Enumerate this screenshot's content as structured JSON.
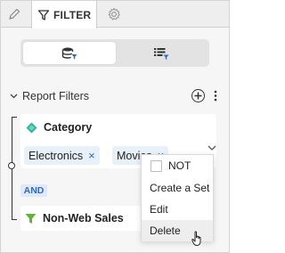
{
  "tabs": {
    "edit_icon": "pencil-icon",
    "filter_icon": "filter-icon",
    "filter_label": "FILTER",
    "settings_icon": "gear-icon"
  },
  "view_toggle": {
    "selected": "dataset",
    "options": [
      "dataset-filter-icon",
      "list-filter-icon"
    ]
  },
  "report_filters": {
    "title": "Report Filters",
    "expanded": true
  },
  "filters": {
    "category": {
      "title": "Category",
      "values": [
        "Electronics",
        "Movies"
      ],
      "remove_glyph": "×"
    },
    "operator": "AND",
    "non_web_sales": {
      "title": "Non-Web Sales"
    }
  },
  "context_menu": {
    "not_label": "NOT",
    "create_set_label": "Create a Set",
    "edit_label": "Edit",
    "delete_label": "Delete",
    "hovered": "Delete"
  },
  "colors": {
    "accent_blue": "#2b6cc4",
    "category_icon": "#2ab89a",
    "filter_icon_green": "#63b33a",
    "chip_bg": "#e8f0f9"
  }
}
